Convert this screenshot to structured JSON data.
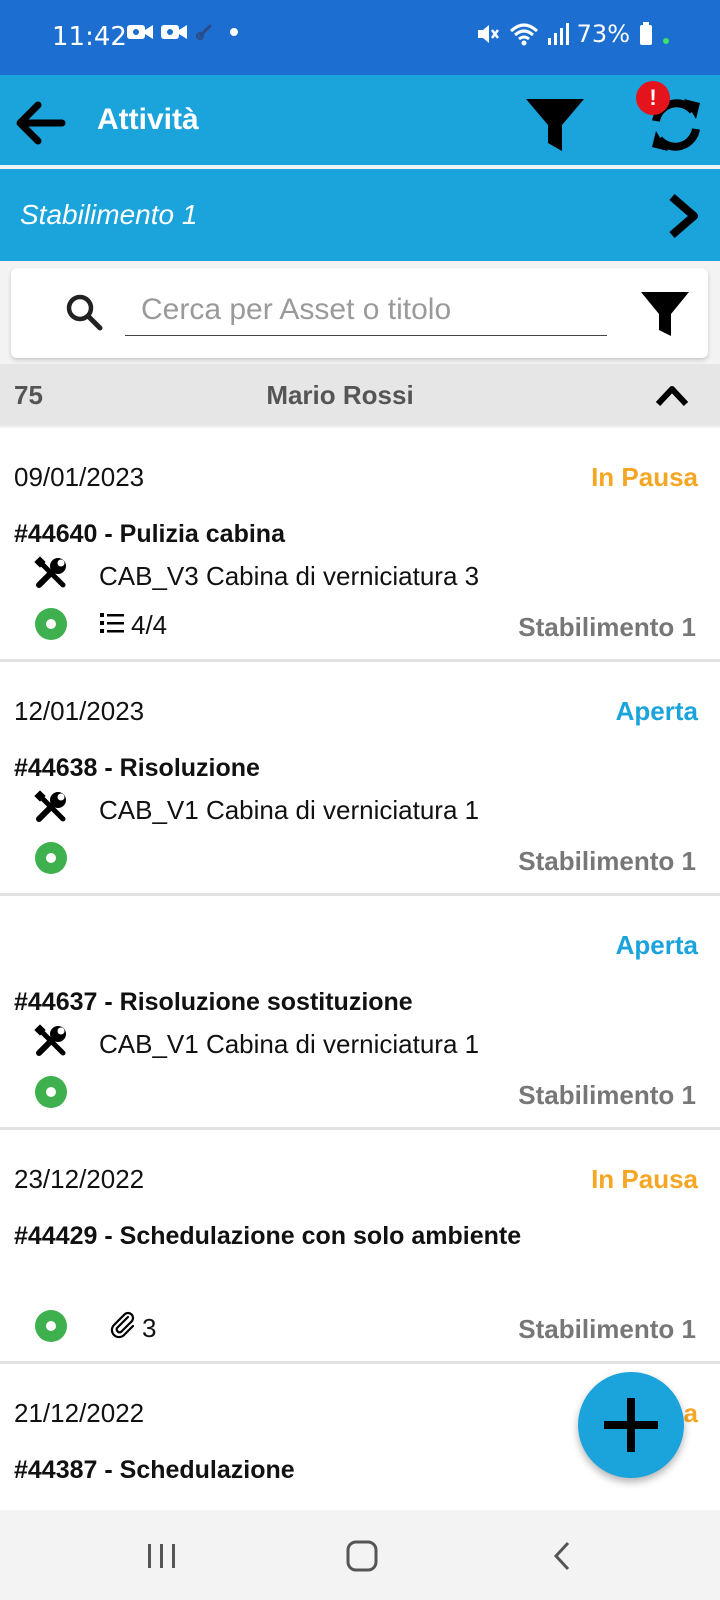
{
  "status_bar": {
    "time": "11:42",
    "battery": "73%"
  },
  "header": {
    "title": "Attività",
    "badge": "!"
  },
  "plant_bar": {
    "name": "Stabilimento 1"
  },
  "search": {
    "placeholder": "Cerca per Asset o titolo"
  },
  "group": {
    "count": "75",
    "user": "Mario Rossi"
  },
  "colors": {
    "primary": "#1ba3dc",
    "status_bar": "#1c6fd0",
    "paused": "#f5a623",
    "open": "#1ba3dc",
    "active_dot": "#3fb04e"
  },
  "tasks": [
    {
      "date": "09/01/2023",
      "status": "In Pausa",
      "title": "#44640 - Pulizia cabina",
      "asset": "CAB_V3 Cabina di verniciatura 3",
      "checklist": "4/4",
      "plant": "Stabilimento 1"
    },
    {
      "date": "12/01/2023",
      "status": "Aperta",
      "title": "#44638 - Risoluzione",
      "asset": "CAB_V1 Cabina di verniciatura 1",
      "plant": "Stabilimento 1"
    },
    {
      "date": "",
      "status": "Aperta",
      "title": "#44637 - Risoluzione sostituzione",
      "asset": "CAB_V1 Cabina di verniciatura 1",
      "plant": "Stabilimento 1"
    },
    {
      "date": "23/12/2022",
      "status": "In Pausa",
      "title": "#44429 - Schedulazione con solo ambiente",
      "attachments": "3",
      "plant": "Stabilimento 1"
    },
    {
      "date": "21/12/2022",
      "status": "In Pausa",
      "title": "#44387 - Schedulazione"
    }
  ]
}
